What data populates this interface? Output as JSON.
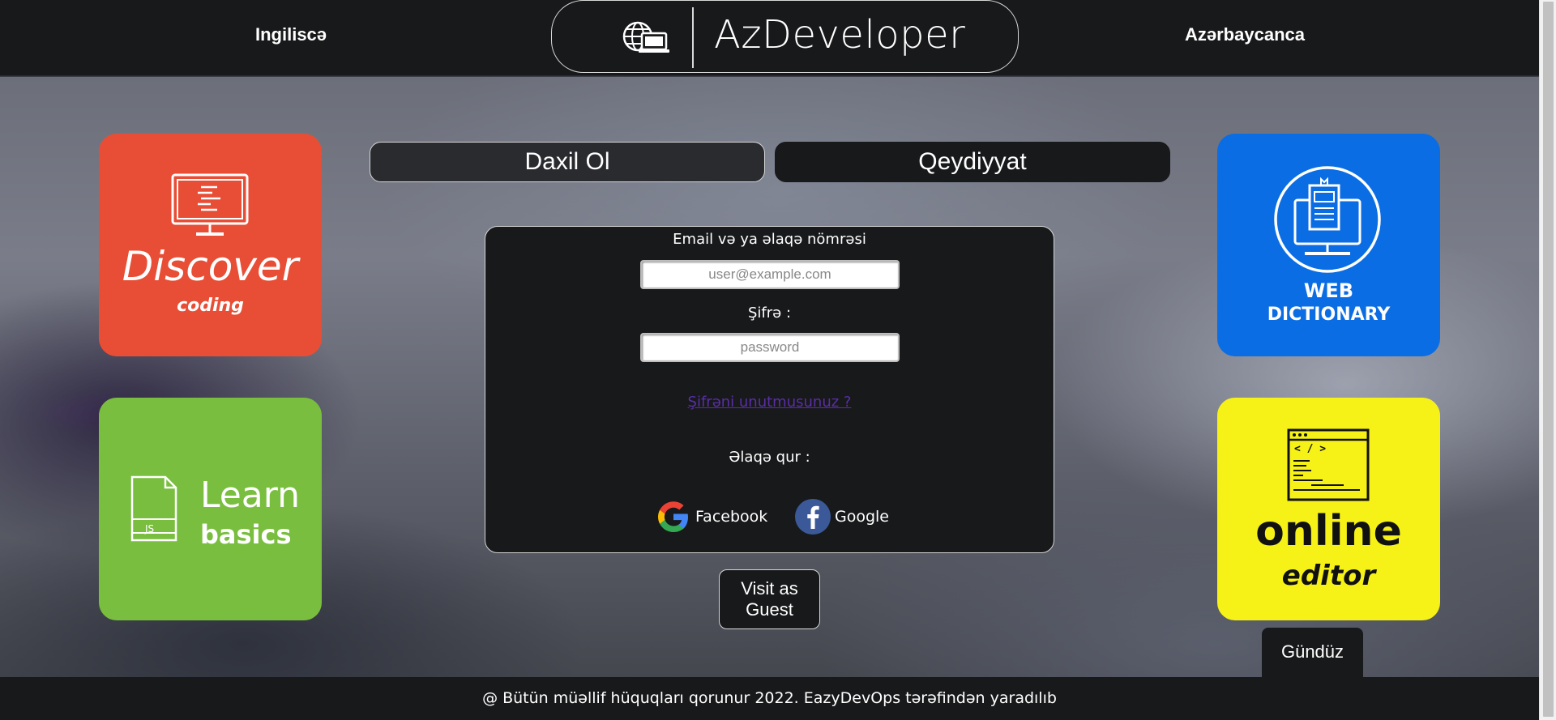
{
  "header": {
    "lang_left": "Ingiliscə",
    "lang_right": "Azərbaycanca",
    "brand": "AzDeveloper"
  },
  "tiles": {
    "discover": {
      "line1": "Discover",
      "line2": "coding",
      "color": "#e84e35"
    },
    "learn": {
      "line1": "Learn",
      "line2": "basics",
      "badge": "JS",
      "color": "#79be3e"
    },
    "web_dictionary": {
      "line1": "WEB",
      "line2": "DICTIONARY",
      "color": "#0b6de3"
    },
    "online_editor": {
      "line1": "online",
      "line2": "editor",
      "code": "< / >",
      "color": "#f6f217"
    }
  },
  "tabs": {
    "login": "Daxil Ol",
    "register": "Qeydiyyat"
  },
  "form": {
    "email_label": "Email və ya əlaqə nömrəsi",
    "email_placeholder": "user@example.com",
    "password_label": "Şifrə :",
    "password_placeholder": "password",
    "forgot_link": "Şifrəni unutmusunuz ?",
    "connect_label": "Əlaqə qur :",
    "social": [
      {
        "icon": "google-icon",
        "label": "Facebook"
      },
      {
        "icon": "facebook-icon",
        "label": "Google"
      }
    ]
  },
  "guest_button": {
    "line1": "Visit as",
    "line2": "Guest"
  },
  "day_mode_button": "Gündüz",
  "footer": "@ Bütün müəllif hüquqları qorunur 2022. EazyDevOps tərəfindən yaradılıb"
}
